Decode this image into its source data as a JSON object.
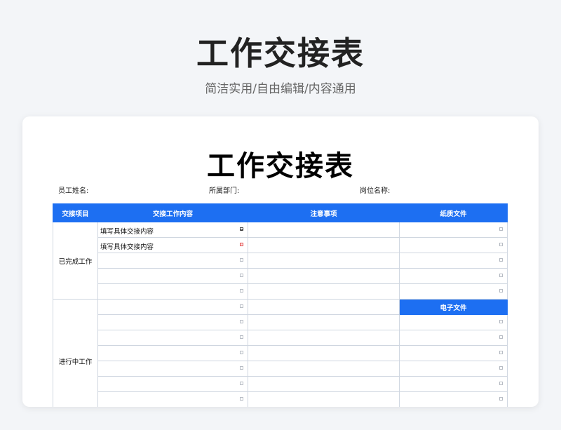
{
  "hero": {
    "title": "工作交接表",
    "subtitle": "简洁实用/自由编辑/内容通用"
  },
  "doc": {
    "title": "工作交接表",
    "fields": {
      "employee_name": "员工姓名:",
      "department": "所属部门:",
      "position": "岗位名称:"
    },
    "columns": {
      "item": "交接项目",
      "content": "交接工作内容",
      "notes": "注意事项",
      "paper_files": "纸质文件",
      "electronic_files": "电子文件"
    },
    "sections": {
      "completed": "已完成工作",
      "in_progress": "进行中工作"
    },
    "content_rows": [
      "填写具体交接内容",
      "填写具体交接内容"
    ]
  },
  "colors": {
    "accent": "#1d6ff2",
    "page_bg": "#f3f5f8"
  }
}
